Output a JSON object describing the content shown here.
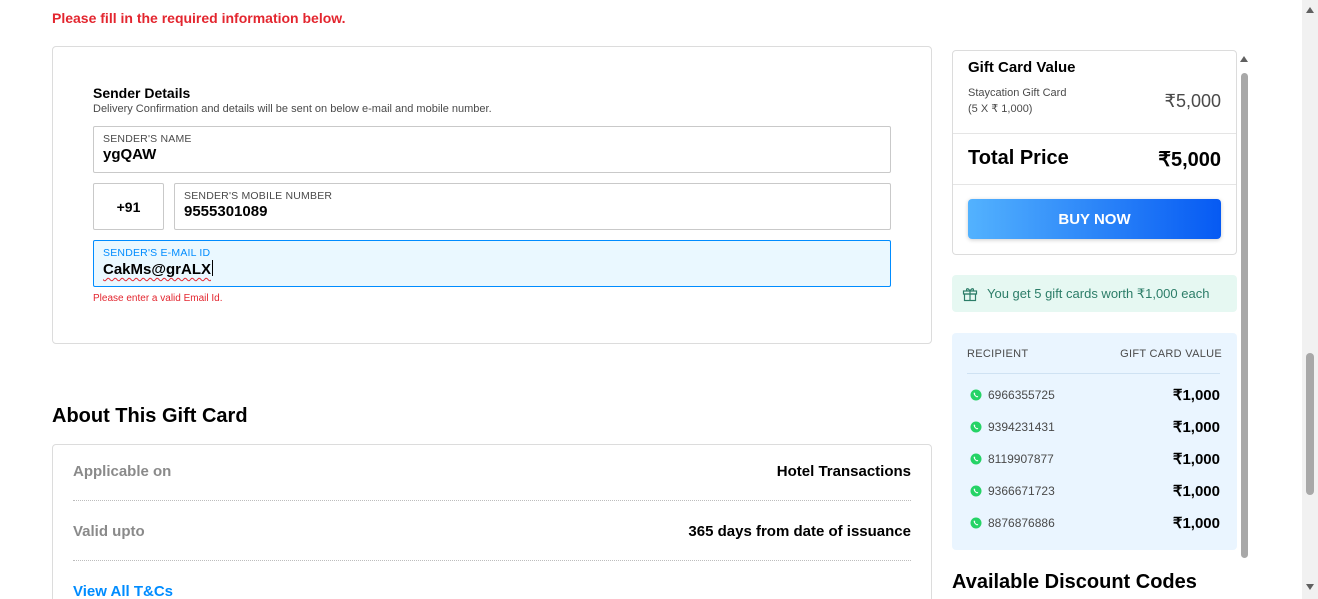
{
  "warning": "Please fill in the required information below.",
  "sender": {
    "title": "Sender Details",
    "subtitle": "Delivery Confirmation and details will be sent on below e-mail and mobile number.",
    "name_label": "SENDER'S NAME",
    "name_value": "ygQAW",
    "country_code": "+91",
    "mobile_label": "SENDER'S MOBILE NUMBER",
    "mobile_value": "9555301089",
    "email_label": "SENDER'S E-MAIL ID",
    "email_value": "CakMs@grALX",
    "email_error": "Please enter a valid Email Id."
  },
  "about": {
    "title": "About This Gift Card",
    "rows": [
      {
        "label": "Applicable on",
        "value": "Hotel Transactions"
      },
      {
        "label": "Valid upto",
        "value": "365 days from date of issuance"
      }
    ],
    "tnc_link": "View All T&Cs"
  },
  "summary": {
    "title": "Gift Card Value",
    "card_name": "Staycation Gift Card",
    "card_breakup": "(5 X ₹ 1,000)",
    "card_amount": "₹5,000",
    "total_label": "Total Price",
    "total_amount": "₹5,000",
    "buy_label": "BUY NOW"
  },
  "promo": {
    "text": "You get 5 gift cards worth ₹1,000 each",
    "icon": "gift-icon"
  },
  "recipients": {
    "header_left": "RECIPIENT",
    "header_right": "GIFT CARD VALUE",
    "icon": "whatsapp-icon",
    "rows": [
      {
        "phone": "6966355725",
        "value": "₹1,000"
      },
      {
        "phone": "9394231431",
        "value": "₹1,000"
      },
      {
        "phone": "8119907877",
        "value": "₹1,000"
      },
      {
        "phone": "9366671723",
        "value": "₹1,000"
      },
      {
        "phone": "8876876886",
        "value": "₹1,000"
      }
    ]
  },
  "discount_title": "Available Discount Codes",
  "colors": {
    "error_red": "#e3262f",
    "link_blue": "#008cff",
    "buy_gradient_start": "#53b2fe",
    "buy_gradient_end": "#065af3",
    "promo_bg": "#e6f8f2",
    "recipient_bg": "#eaf5ff",
    "whatsapp_green": "#25d366"
  }
}
